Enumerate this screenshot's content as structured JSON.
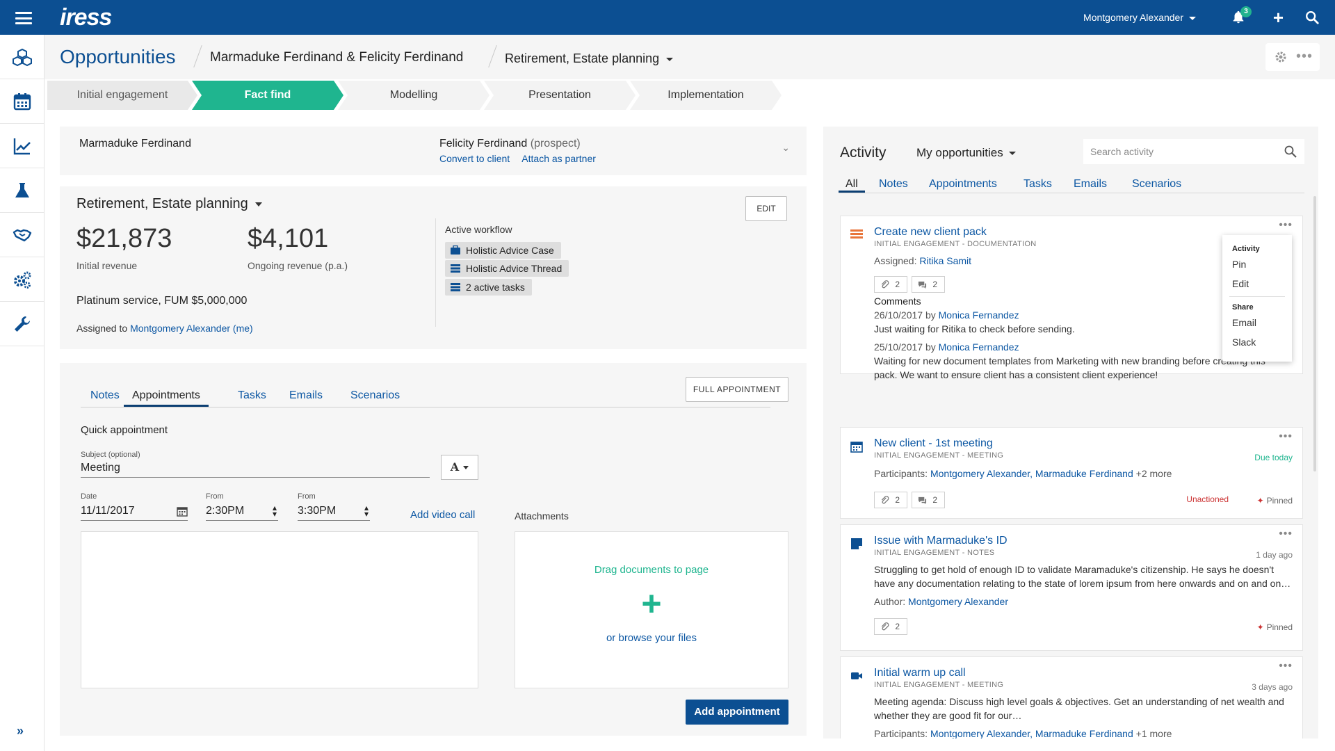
{
  "topbar": {
    "logo": "iress",
    "user": "Montgomery Alexander",
    "notifications_count": "3"
  },
  "header": {
    "title": "Opportunities",
    "clients": "Marmaduke Ferdinand & Felicity Ferdinand",
    "plan": "Retirement, Estate planning"
  },
  "steps": [
    "Initial engagement",
    "Fact find",
    "Modelling",
    "Presentation",
    "Implementation"
  ],
  "client": {
    "primary": "Marmaduke Ferdinand",
    "partner": "Felicity Ferdinand",
    "partner_status": "(prospect)",
    "convert_link": "Convert to client",
    "attach_link": "Attach as partner"
  },
  "opportunity": {
    "title": "Retirement, Estate planning",
    "edit_label": "EDIT",
    "initial_revenue": "$21,873",
    "initial_revenue_label": "Initial revenue",
    "ongoing_revenue": "$4,101",
    "ongoing_revenue_label": "Ongoing revenue (p.a.)",
    "service": "Platinum service,  FUM $5,000,000",
    "assigned_prefix": "Assigned to",
    "assigned_to": "Montgomery Alexander (me)",
    "workflow_label": "Active workflow",
    "workflow_items": [
      "Holistic Advice Case",
      "Holistic Advice Thread",
      "2 active tasks"
    ]
  },
  "appointments": {
    "tabs": [
      "Notes",
      "Appointments",
      "Tasks",
      "Emails",
      "Scenarios"
    ],
    "full_button": "FULL APPOINTMENT",
    "quick_title": "Quick appointment",
    "subject_label": "Subject (optional)",
    "subject_value": "Meeting",
    "font_button": "A",
    "date_label": "Date",
    "date_value": "11/11/2017",
    "from1_label": "From",
    "from1_value": "2:30PM",
    "from2_label": "From",
    "from2_value": "3:30PM",
    "video_link": "Add video call",
    "attachments_label": "Attachments",
    "drop_text": "Drag documents to page",
    "browse_text": "or browse your files",
    "add_button": "Add appointment"
  },
  "activity": {
    "title": "Activity",
    "filter": "My opportunities",
    "search_placeholder": "Search activity",
    "tabs": [
      "All",
      "Notes",
      "Appointments",
      "Tasks",
      "Emails",
      "Scenarios"
    ],
    "items": [
      {
        "title": "Create new client pack",
        "sub": "INITIAL ENGAGEMENT - DOCUMENTATION",
        "assigned_label": "Assigned:",
        "assigned": "Ritika Samit",
        "attachments": "2",
        "comments": "2",
        "comments_label": "Comments",
        "c1_date": "26/10/2017 by",
        "c1_author": "Monica Fernandez",
        "c1_text": "Just waiting for Ritika to check before sending.",
        "c2_date": "25/10/2017 by",
        "c2_author": "Monica Fernandez",
        "c2_text": "Waiting for new document templates from Marketing with new branding before creating this pack. We want to ensure client has a consistent client experience!"
      },
      {
        "title": "New client - 1st meeting",
        "sub": "INITIAL ENGAGEMENT - MEETING",
        "due": "Due today",
        "participants_label": "Participants:",
        "participants": "Montgomery Alexander, Marmaduke Ferdinand",
        "more": "+2 more",
        "attachments": "2",
        "comments": "2",
        "status": "Unactioned",
        "pinned": "Pinned"
      },
      {
        "title": "Issue with Marmaduke's ID",
        "sub": "INITIAL ENGAGEMENT - NOTES",
        "time": "1 day ago",
        "text": "Struggling to get hold of enough ID to validate Maramaduke's citizenship. He says he doesn't have any documentation relating to the state of lorem ipsum from here onwards and on and on…",
        "author_label": "Author:",
        "author": "Montgomery Alexander",
        "attachments": "2",
        "pinned": "Pinned"
      },
      {
        "title": "Initial warm up call",
        "sub": "INITIAL ENGAGEMENT - MEETING",
        "time": "3 days ago",
        "text": "Meeting agenda: Discuss high level goals & objectives. Get an understanding of net wealth and whether they are good fit for our…",
        "participants_label": "Participants:",
        "participants": "Montgomery Alexander, Marmaduke Ferdinand",
        "more": "+1 more"
      }
    ],
    "menu": {
      "section1": "Activity",
      "pin": "Pin",
      "edit": "Edit",
      "section2": "Share",
      "email": "Email",
      "slack": "Slack"
    }
  },
  "colors": {
    "brand": "#0c4f92",
    "accent": "#1fb58f",
    "link": "#0c57a3",
    "warning": "#cc3333"
  }
}
